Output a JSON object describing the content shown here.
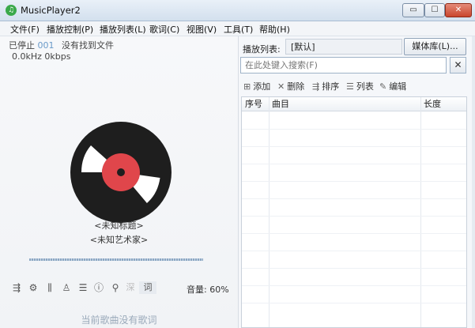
{
  "window": {
    "title": "MusicPlayer2",
    "min_label": "▭",
    "max_label": "☐",
    "close_label": "✕"
  },
  "menu": [
    "文件(F)",
    "播放控制(P)",
    "播放列表(L)",
    "歌词(C)",
    "视图(V)",
    "工具(T)",
    "帮助(H)"
  ],
  "player": {
    "state": "已停止",
    "index": "001",
    "track_status": "没有找到文件",
    "format": "0.0kHz 0kbps",
    "title": "<未知标题>",
    "artist": "<未知艺术家>",
    "volume": "音量: 60%",
    "no_lyrics": "当前歌曲没有歌词"
  },
  "controls": [
    {
      "name": "playlist-icon",
      "glyph": "⇶"
    },
    {
      "name": "settings-icon",
      "glyph": "⚙"
    },
    {
      "name": "equalizer-icon",
      "glyph": "⫼"
    },
    {
      "name": "skin-icon",
      "glyph": "♙"
    },
    {
      "name": "menu-icon",
      "glyph": "☰"
    },
    {
      "name": "info-icon",
      "glyph": "ⓘ"
    },
    {
      "name": "search-icon",
      "glyph": "⚲"
    },
    {
      "name": "deep-search-icon",
      "glyph": "深"
    },
    {
      "name": "lyrics-icon",
      "glyph": "词"
    }
  ],
  "playlist": {
    "label": "播放列表:",
    "name": "[默认]",
    "media_button": "媒体库(L)...",
    "search_placeholder": "在此处键入搜索(F)",
    "clear_label": "✕",
    "toolbar": {
      "add": "添加",
      "remove": "删除",
      "sort": "排序",
      "list": "列表",
      "edit": "编辑"
    },
    "columns": [
      "序号",
      "曲目",
      "长度"
    ]
  },
  "colors": {
    "disc": "#1e1e1e",
    "label": "#e0464b",
    "accent": "#6a9ac9"
  }
}
